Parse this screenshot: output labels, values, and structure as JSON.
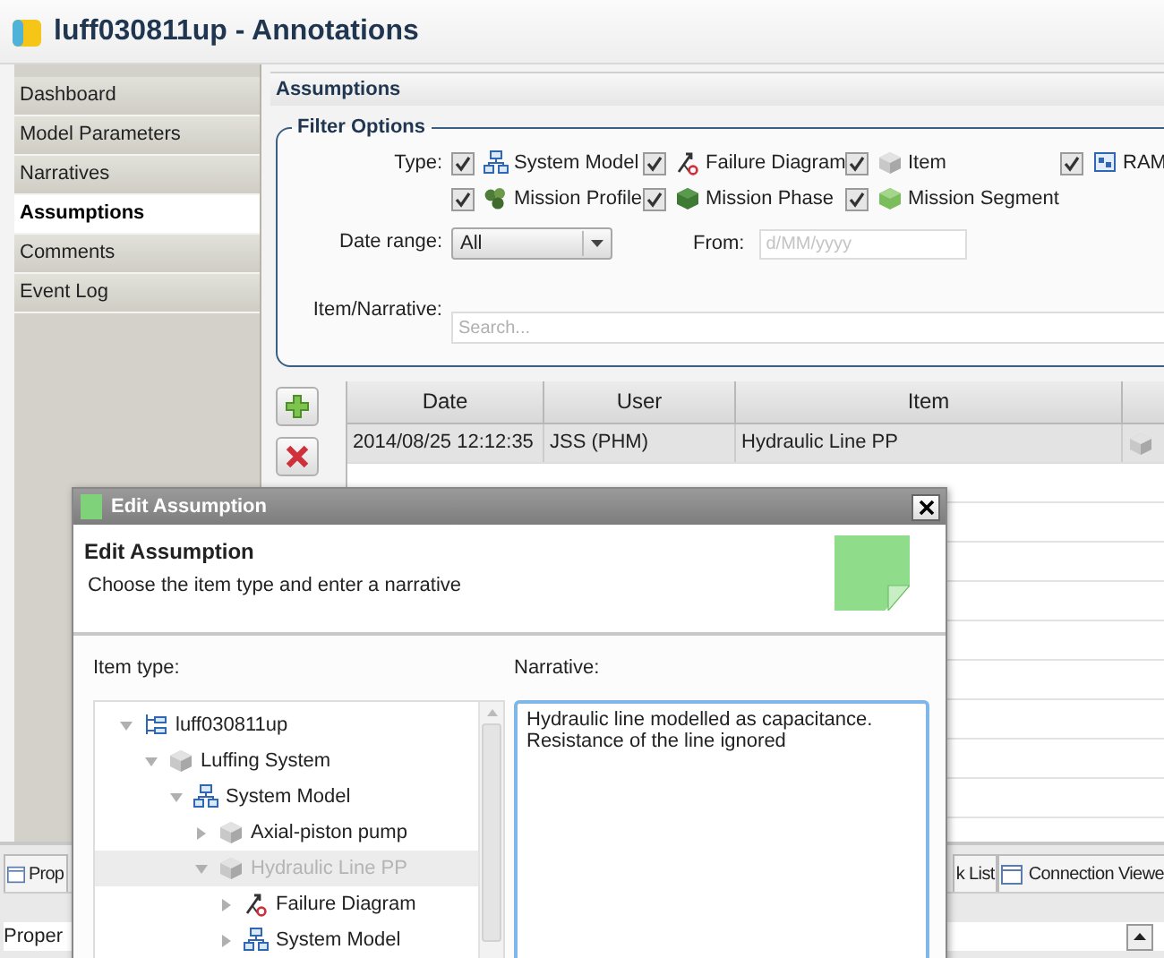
{
  "window": {
    "title": "luff030811up - Annotations"
  },
  "sidebar": {
    "items": [
      {
        "label": "Dashboard",
        "selected": false
      },
      {
        "label": "Model Parameters",
        "selected": false
      },
      {
        "label": "Narratives",
        "selected": false
      },
      {
        "label": "Assumptions",
        "selected": true
      },
      {
        "label": "Comments",
        "selected": false
      },
      {
        "label": "Event Log",
        "selected": false
      }
    ]
  },
  "section": {
    "title": "Assumptions"
  },
  "filter": {
    "title": "Filter Options",
    "type_label": "Type:",
    "types": [
      {
        "label": "System Model",
        "kind": "system_model",
        "checked": true
      },
      {
        "label": "Failure Diagram",
        "kind": "failure_diagram",
        "checked": true
      },
      {
        "label": "Item",
        "kind": "item",
        "checked": true
      },
      {
        "label": "RAM",
        "kind": "ram",
        "checked": true
      },
      {
        "label": "Mission Profile",
        "kind": "mission_profile",
        "checked": true
      },
      {
        "label": "Mission Phase",
        "kind": "mission_phase",
        "checked": true
      },
      {
        "label": "Mission Segment",
        "kind": "mission_segment",
        "checked": true
      }
    ],
    "date_range": {
      "label": "Date range:",
      "value": "All"
    },
    "from": {
      "label": "From:",
      "placeholder": "d/MM/yyyy"
    },
    "search": {
      "label": "Item/Narrative:",
      "placeholder": "Search..."
    }
  },
  "table": {
    "columns": [
      "Date",
      "User",
      "Item"
    ],
    "rows": [
      {
        "cells": [
          "2014/08/25 12:12:35",
          "JSS (PHM)",
          "Hydraulic Line PP"
        ],
        "selected": true
      }
    ]
  },
  "bottom_panel": {
    "tabs": [
      {
        "label": "Prop"
      },
      {
        "label": "k List"
      },
      {
        "label": "Connection Viewe"
      }
    ],
    "text": "Proper"
  },
  "dialog": {
    "window_title": "Edit Assumption",
    "heading": "Edit Assumption",
    "subtitle": "Choose the item type and enter a narrative",
    "item_type_label": "Item type:",
    "narrative_label": "Narrative:",
    "narrative": "Hydraulic line modelled as capacitance.\nResistance of the line ignored",
    "tree": [
      {
        "label": "luff030811up",
        "kind": "project",
        "expanded": true,
        "selected": false,
        "children": [
          {
            "label": "Luffing System",
            "kind": "item",
            "expanded": true,
            "selected": false,
            "children": [
              {
                "label": "System Model",
                "kind": "system_model",
                "expanded": true,
                "selected": false,
                "children": [
                  {
                    "label": "Axial-piston pump",
                    "kind": "item",
                    "expanded": false,
                    "selected": false
                  },
                  {
                    "label": "Hydraulic Line PP",
                    "kind": "item",
                    "expanded": true,
                    "selected": true,
                    "children": [
                      {
                        "label": "Failure Diagram",
                        "kind": "failure_diagram",
                        "expanded": false,
                        "selected": false
                      },
                      {
                        "label": "System Model",
                        "kind": "system_model",
                        "expanded": false,
                        "selected": false
                      }
                    ]
                  }
                ]
              }
            ]
          }
        ]
      }
    ]
  }
}
